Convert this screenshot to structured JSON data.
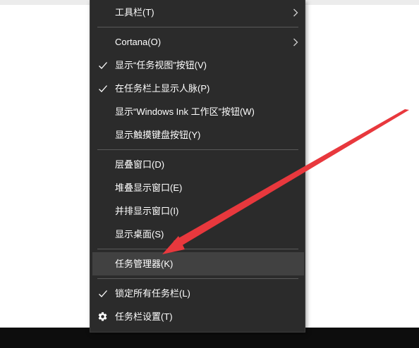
{
  "menu": {
    "toolbars": "工具栏(T)",
    "cortana": "Cortana(O)",
    "show_task_view": "显示“任务视图”按钮(V)",
    "show_people": "在任务栏上显示人脉(P)",
    "show_ink_workspace": "显示“Windows Ink 工作区”按钮(W)",
    "show_touch_keyboard": "显示触摸键盘按钮(Y)",
    "cascade_windows": "层叠窗口(D)",
    "stack_windows": "堆叠显示窗口(E)",
    "side_by_side": "并排显示窗口(I)",
    "show_desktop": "显示桌面(S)",
    "task_manager": "任务管理器(K)",
    "lock_taskbars": "锁定所有任务栏(L)",
    "taskbar_settings": "任务栏设置(T)"
  },
  "colors": {
    "menu_background": "#2b2b2b",
    "highlight": "#414141",
    "text": "#ffffff",
    "annotation_arrow": "#e8383d"
  },
  "icons": {
    "check": "check-icon",
    "submenu": "chevron-right-icon",
    "settings": "gear-icon"
  }
}
